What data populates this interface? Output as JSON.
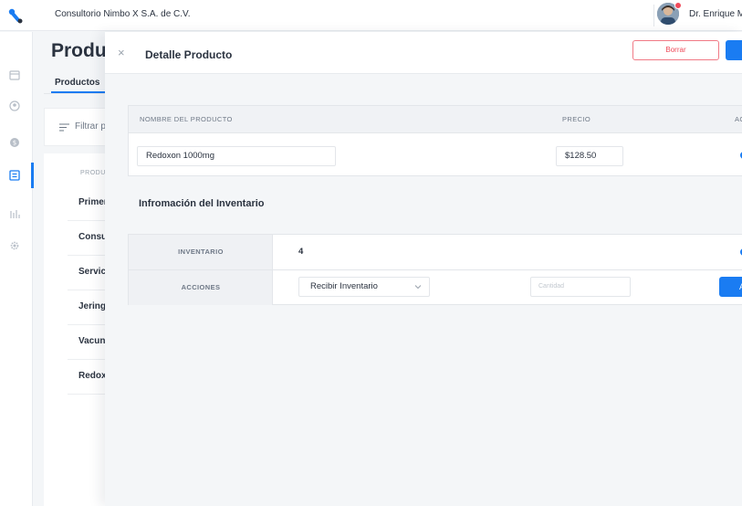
{
  "topbar": {
    "company": "Consultorio Nimbo X S.A. de C.V.",
    "user_name": "Dr. Enrique M",
    "accent": "#1a7cf2",
    "notification_color": "#ef4a5a"
  },
  "sidebar": {
    "items": [
      {
        "icon": "calendar-icon"
      },
      {
        "icon": "user-icon"
      },
      {
        "icon": "coin-icon"
      },
      {
        "icon": "list-icon",
        "active": true
      },
      {
        "icon": "chart-bar-icon"
      },
      {
        "icon": "gear-icon"
      }
    ]
  },
  "background": {
    "title": "Produ",
    "tab": "Productos",
    "filter_text": "Filtrar p",
    "column_header": "PRODU",
    "rows": [
      "Primer",
      "Consu",
      "Servic",
      "Jering",
      "Vacun",
      "Redox"
    ]
  },
  "panel": {
    "close": "×",
    "title": "Detalle Producto",
    "delete_label": "Borrar",
    "product_table": {
      "headers": {
        "name": "NOMBRE DEL PRODUCTO",
        "price": "PRECIO",
        "active": "AC"
      },
      "name_value": "Redoxon 1000mg",
      "price_value": "$128.50"
    },
    "inventory_section_title": "Infromación del Inventario",
    "inventory": {
      "inventory_label": "INVENTARIO",
      "inventory_value": "4",
      "actions_label": "ACCIONES",
      "action_selected": "Recibir Inventario",
      "quantity_placeholder": "Cantidad",
      "apply_label": "A"
    }
  }
}
